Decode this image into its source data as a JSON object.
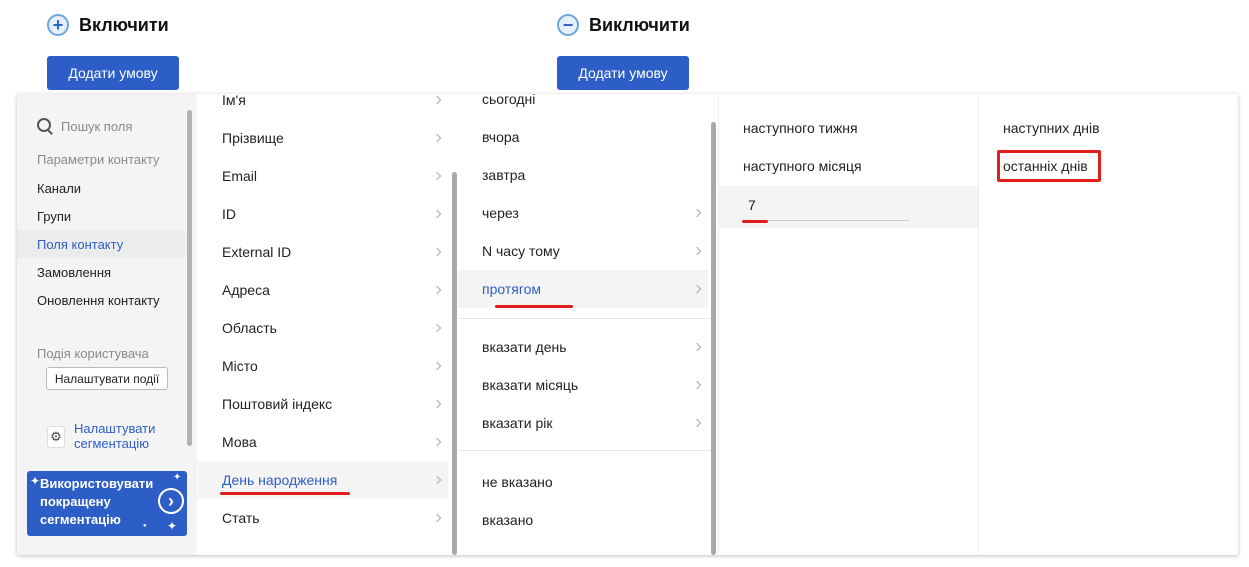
{
  "include": {
    "icon": "plus-icon",
    "symbol": "+",
    "title": "Включити",
    "button": "Додати умову"
  },
  "exclude": {
    "icon": "minus-icon",
    "symbol": "−",
    "title": "Виключити",
    "button": "Додати умову"
  },
  "sidebar": {
    "search_placeholder": "Пошук поля",
    "contact_params_label": "Параметри контакту",
    "items": [
      "Канали",
      "Групи",
      "Поля контакту",
      "Замовлення",
      "Оновлення контакту"
    ],
    "active_item": "Поля контакту",
    "user_event_label": "Подія користувача",
    "configure_events_button": "Налаштувати події",
    "configure_segmentation_line1": "Налаштувати",
    "configure_segmentation_line2": "сегментацію",
    "promo_text": "Використовувати покращену сегментацію"
  },
  "fields_column": {
    "items": [
      "Ім'я",
      "Прізвище",
      "Email",
      "ID",
      "External ID",
      "Адреса",
      "Область",
      "Місто",
      "Поштовий індекс",
      "Мова",
      "День народження",
      "Стать"
    ],
    "active": "День народження"
  },
  "conditions_column": {
    "group1": [
      "сьогодні",
      "вчора",
      "завтра",
      "через",
      "N часу тому",
      "протягом"
    ],
    "group2": [
      "вказати день",
      "вказати місяць",
      "вказати рік"
    ],
    "group3": [
      "не вказано",
      "вказано"
    ],
    "active": "протягом"
  },
  "period_column": {
    "items": [
      "наступного тижня",
      "наступного місяця"
    ],
    "number_value": "7"
  },
  "days_column": {
    "items": [
      "наступних днів",
      "останніх днів"
    ],
    "highlighted": "останніх днів"
  },
  "colors": {
    "accent": "#2d5ec8",
    "highlight": "#e31c1c",
    "sidebar_bg": "#f4f4f4"
  }
}
